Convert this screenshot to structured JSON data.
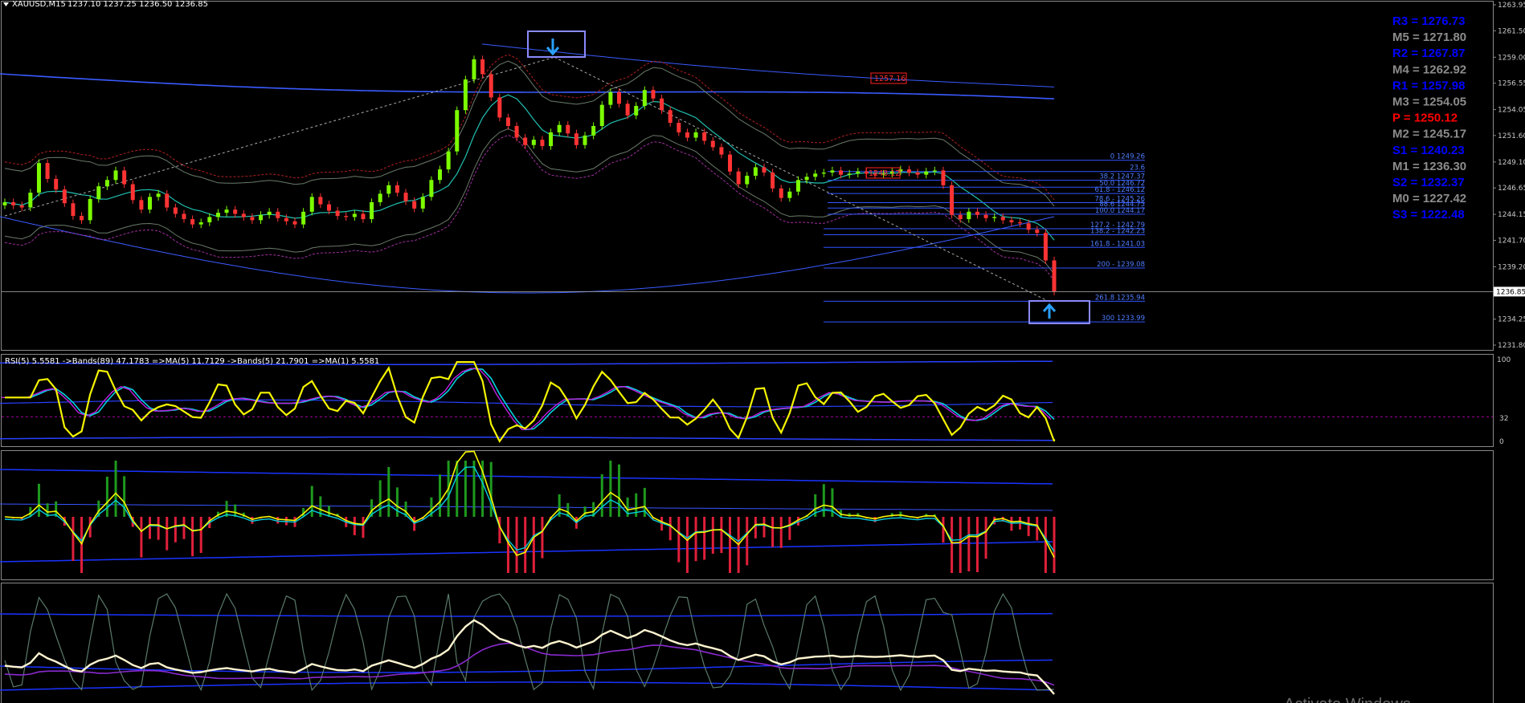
{
  "header": {
    "symbol": "XAUUSD,M15",
    "ohlc": "1237.10 1237.25 1236.50 1236.85",
    "dropdown_icon": "triangle-down-icon"
  },
  "colors": {
    "background": "#000000",
    "bull": "#7cfc00",
    "bear": "#ff3333",
    "fib": "#3355ff",
    "pivot_resistance": "#0000ff",
    "pivot_mid": "#8c8c8c",
    "pivot_p": "#ff0000"
  },
  "price_axis": {
    "labels": [
      "1263.95",
      "1261.50",
      "1259.00",
      "1256.55",
      "1254.05",
      "1251.60",
      "1249.10",
      "1246.65",
      "1244.15",
      "1241.70",
      "1239.20",
      "1236.85",
      "1234.25",
      "1231.80"
    ],
    "current": "1236.85"
  },
  "pivots": [
    {
      "text": "R3 = 1276.73",
      "color": "#0000ff"
    },
    {
      "text": "M5 = 1271.80",
      "color": "#8c8c8c"
    },
    {
      "text": "R2 = 1267.87",
      "color": "#0000ff"
    },
    {
      "text": "M4 = 1262.92",
      "color": "#8c8c8c"
    },
    {
      "text": "R1 = 1257.98",
      "color": "#0000ff"
    },
    {
      "text": "M3 = 1254.05",
      "color": "#8c8c8c"
    },
    {
      "text": "P   = 1250.12",
      "color": "#ff0000"
    },
    {
      "text": "M2 = 1245.17",
      "color": "#8c8c8c"
    },
    {
      "text": "S1 = 1240.23",
      "color": "#0000ff"
    },
    {
      "text": "M1 = 1236.30",
      "color": "#8c8c8c"
    },
    {
      "text": "S2 = 1232.37",
      "color": "#0000ff"
    },
    {
      "text": "M0 = 1227.42",
      "color": "#8c8c8c"
    },
    {
      "text": "S3 = 1222.48",
      "color": "#0000ff"
    }
  ],
  "fibonacci": {
    "levels": [
      {
        "label": "0 1249.26",
        "price": 1249.26
      },
      {
        "label": "23.6",
        "price": 1248.2
      },
      {
        "label": "38.2 1247.37",
        "price": 1247.37
      },
      {
        "label": "50.0 1246.72",
        "price": 1246.72
      },
      {
        "label": "61.8 - 1246.12",
        "price": 1246.12
      },
      {
        "label": "78.6 - 1245.26",
        "price": 1245.26
      },
      {
        "label": "88.6 1244.75",
        "price": 1244.75
      },
      {
        "label": "100.0 1244.17",
        "price": 1244.17
      },
      {
        "label": "127.2 - 1242.79",
        "price": 1242.79
      },
      {
        "label": "138.2 - 1242.23",
        "price": 1242.23
      },
      {
        "label": "161.8 - 1241.03",
        "price": 1241.03
      },
      {
        "label": "200 - 1239.08",
        "price": 1239.08
      },
      {
        "label": "261.8 1235.94",
        "price": 1235.94
      },
      {
        "label": "300 1233.99",
        "price": 1233.99
      }
    ]
  },
  "price_tags": [
    {
      "text": "1257.16",
      "price": 1257.16
    },
    {
      "text": "1248.12",
      "price": 1248.12
    }
  ],
  "signals": [
    {
      "type": "sell",
      "icon": "arrow-down-icon",
      "price": 1258.9
    },
    {
      "type": "buy",
      "icon": "arrow-up-icon",
      "price": 1235.5
    }
  ],
  "rsi_panel": {
    "title": "RSI(5) 5.5581  ->Bands(89) 47.1783  =>MA(5) 11.7129  ->Bands(5) 21.7901  =>MA(1) 5.5581",
    "axis": [
      "100",
      "32",
      "0"
    ],
    "level": 32
  },
  "macd_panel": {
    "name": "histogram-panel"
  },
  "osc_panel": {
    "name": "oscillator-panel"
  },
  "watermark": "Activate Windows",
  "chart_data": {
    "type": "candlestick",
    "symbol": "XAUUSD",
    "timeframe": "M15",
    "ylim": [
      1231.8,
      1263.95
    ],
    "last_close": 1236.85,
    "swing_high": 1259.0,
    "swing_low": 1235.9,
    "close_path": [
      1245.3,
      1245.0,
      1244.8,
      1246.2,
      1249.0,
      1247.5,
      1246.5,
      1245.2,
      1244.0,
      1243.6,
      1245.6,
      1246.8,
      1247.4,
      1248.3,
      1247.0,
      1245.5,
      1244.6,
      1245.8,
      1246.1,
      1244.8,
      1244.2,
      1243.7,
      1243.2,
      1243.4,
      1243.9,
      1244.3,
      1244.6,
      1244.2,
      1243.9,
      1243.6,
      1244.1,
      1244.4,
      1243.8,
      1243.5,
      1243.2,
      1244.4,
      1245.8,
      1245.1,
      1244.5,
      1244.0,
      1243.9,
      1244.2,
      1243.7,
      1245.3,
      1246.1,
      1246.9,
      1246.2,
      1245.4,
      1244.7,
      1245.8,
      1247.4,
      1248.4,
      1250.1,
      1254.0,
      1256.9,
      1258.8,
      1257.4,
      1255.2,
      1253.3,
      1252.5,
      1251.4,
      1250.7,
      1251.2,
      1250.6,
      1251.9,
      1252.6,
      1251.8,
      1250.7,
      1251.6,
      1252.5,
      1254.5,
      1255.7,
      1254.6,
      1253.5,
      1254.4,
      1255.9,
      1255.1,
      1254.0,
      1252.8,
      1251.9,
      1251.4,
      1251.9,
      1251.1,
      1250.5,
      1249.8,
      1248.2,
      1247.0,
      1247.8,
      1248.6,
      1248.1,
      1246.6,
      1245.7,
      1246.3,
      1247.4,
      1247.7,
      1248.0,
      1248.1,
      1248.3,
      1247.9,
      1248.0,
      1248.2,
      1248.0,
      1247.9,
      1248.0,
      1248.2,
      1248.4,
      1248.1,
      1247.9,
      1248.2,
      1248.3,
      1246.9,
      1244.1,
      1243.7,
      1244.4,
      1244.1,
      1243.8,
      1243.9,
      1243.6,
      1243.4,
      1243.3,
      1242.7,
      1242.4,
      1239.8,
      1236.85
    ],
    "rsi": {
      "range": [
        0,
        100
      ],
      "value": 5.5581,
      "bands89": 47.1783,
      "ma5": 11.7129,
      "bands5": 21.7901,
      "ma1": 5.5581
    }
  }
}
